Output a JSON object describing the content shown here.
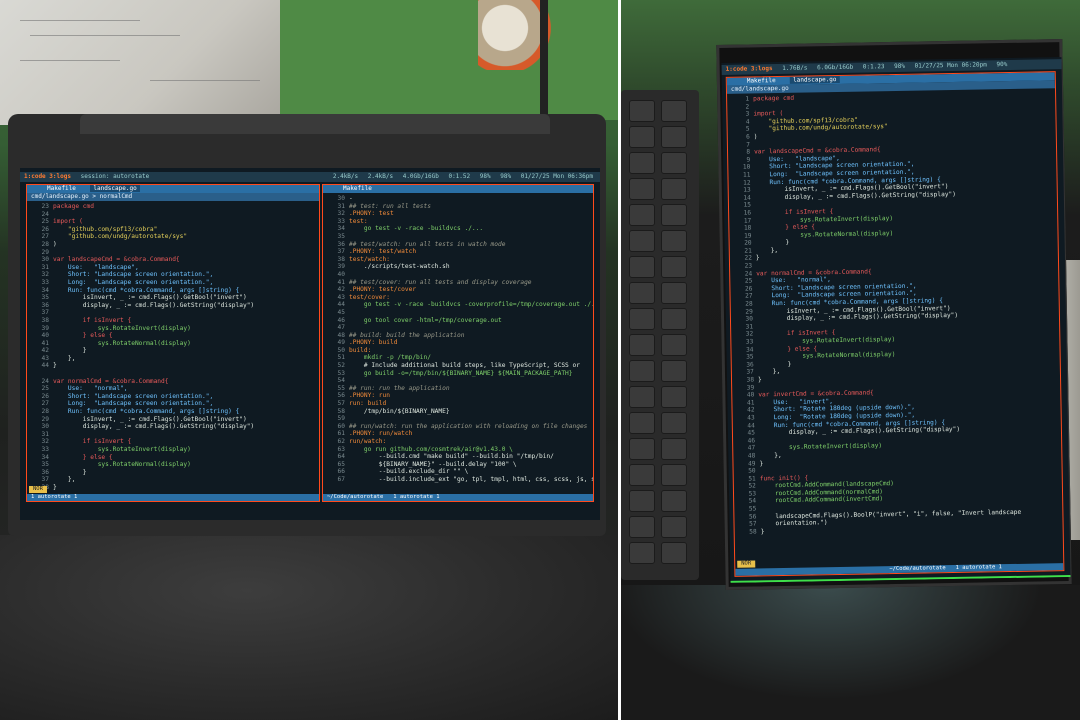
{
  "left": {
    "tmux": {
      "windows": "1:code  3:logs",
      "session": "session: autorotate",
      "net": "2.4kB/s",
      "net2": "2.4kB/s",
      "mem": "4.0Gb/16Gb",
      "load": "0:1.52",
      "batt": "98%",
      "batt2": "98%",
      "datetime": "01/27/25 Mon 06:36pm",
      "cpu": "4%"
    },
    "left_pane": {
      "tab1": "Makefile",
      "tab2": "landscape.go",
      "path": "cmd/landscape.go",
      "fn_hint": "normalCmd",
      "mode": "NOR",
      "bottom": "1 autorotate 1"
    },
    "right_pane": {
      "tab": "Makefile",
      "path": "~/Code/autorotate",
      "bottom": "1 autorotate 1"
    },
    "code_left": [
      {
        "n": "23",
        "t": "package cmd"
      },
      {
        "n": "24",
        "t": ""
      },
      {
        "n": "25",
        "t": "import ("
      },
      {
        "n": "26",
        "t": "    \"github.com/spf13/cobra\""
      },
      {
        "n": "27",
        "t": "    \"github.com/undg/autorotate/sys\""
      },
      {
        "n": "28",
        "t": ")"
      },
      {
        "n": "29",
        "t": ""
      },
      {
        "n": "30",
        "t": "var landscapeCmd = &cobra.Command{"
      },
      {
        "n": "31",
        "t": "    Use:   \"landscape\","
      },
      {
        "n": "32",
        "t": "    Short: \"Landscape screen orientation.\","
      },
      {
        "n": "33",
        "t": "    Long:  \"Landscape screen orientation.\","
      },
      {
        "n": "34",
        "t": "    Run: func(cmd *cobra.Command, args []string) {"
      },
      {
        "n": "35",
        "t": "        isInvert, _ := cmd.Flags().GetBool(\"invert\")"
      },
      {
        "n": "36",
        "t": "        display, _ := cmd.Flags().GetString(\"display\")"
      },
      {
        "n": "37",
        "t": ""
      },
      {
        "n": "38",
        "t": "        if isInvert {"
      },
      {
        "n": "39",
        "t": "            sys.RotateInvert(display)"
      },
      {
        "n": "40",
        "t": "        } else {"
      },
      {
        "n": "41",
        "t": "            sys.RotateNormal(display)"
      },
      {
        "n": "42",
        "t": "        }"
      },
      {
        "n": "43",
        "t": "    },"
      },
      {
        "n": "44",
        "t": "}"
      },
      {
        "n": "",
        "t": ""
      },
      {
        "n": "24",
        "t": "var normalCmd = &cobra.Command{"
      },
      {
        "n": "25",
        "t": "    Use:   \"normal\","
      },
      {
        "n": "26",
        "t": "    Short: \"Landscape screen orientation.\","
      },
      {
        "n": "27",
        "t": "    Long:  \"Landscape screen orientation.\","
      },
      {
        "n": "28",
        "t": "    Run: func(cmd *cobra.Command, args []string) {"
      },
      {
        "n": "29",
        "t": "        isInvert, _ := cmd.Flags().GetBool(\"invert\")"
      },
      {
        "n": "30",
        "t": "        display, _ := cmd.Flags().GetString(\"display\")"
      },
      {
        "n": "31",
        "t": ""
      },
      {
        "n": "32",
        "t": "        if isInvert {"
      },
      {
        "n": "33",
        "t": "            sys.RotateInvert(display)"
      },
      {
        "n": "34",
        "t": "        } else {"
      },
      {
        "n": "35",
        "t": "            sys.RotateNormal(display)"
      },
      {
        "n": "36",
        "t": "        }"
      },
      {
        "n": "37",
        "t": "    },"
      },
      {
        "n": "38",
        "t": "}"
      }
    ],
    "code_right": [
      {
        "n": "30",
        "t": "-"
      },
      {
        "n": "31",
        "t": "## test: run all tests"
      },
      {
        "n": "32",
        "t": ".PHONY: test"
      },
      {
        "n": "33",
        "t": "test:"
      },
      {
        "n": "34",
        "t": "    go test -v -race -buildvcs ./..."
      },
      {
        "n": "35",
        "t": ""
      },
      {
        "n": "36",
        "t": "## test/watch: run all tests in watch mode"
      },
      {
        "n": "37",
        "t": ".PHONY: test/watch"
      },
      {
        "n": "38",
        "t": "test/watch:"
      },
      {
        "n": "39",
        "t": "    ./scripts/test-watch.sh"
      },
      {
        "n": "40",
        "t": ""
      },
      {
        "n": "41",
        "t": "## test/cover: run all tests and display coverage"
      },
      {
        "n": "42",
        "t": ".PHONY: test/cover"
      },
      {
        "n": "43",
        "t": "test/cover:"
      },
      {
        "n": "44",
        "t": "    go test -v -race -buildvcs -coverprofile=/tmp/coverage.out ./..."
      },
      {
        "n": "45",
        "t": ""
      },
      {
        "n": "46",
        "t": "    go tool cover -html=/tmp/coverage.out"
      },
      {
        "n": "47",
        "t": ""
      },
      {
        "n": "48",
        "t": "## build: build the application"
      },
      {
        "n": "49",
        "t": ".PHONY: build"
      },
      {
        "n": "50",
        "t": "build:"
      },
      {
        "n": "51",
        "t": "    mkdir -p /tmp/bin/"
      },
      {
        "n": "52",
        "t": "    # Include additional build steps, like TypeScript, SCSS or"
      },
      {
        "n": "53",
        "t": "    go build -o=/tmp/bin/${BINARY_NAME} ${MAIN_PACKAGE_PATH}"
      },
      {
        "n": "54",
        "t": ""
      },
      {
        "n": "55",
        "t": "## run: run the application"
      },
      {
        "n": "56",
        "t": ".PHONY: run"
      },
      {
        "n": "57",
        "t": "run: build"
      },
      {
        "n": "58",
        "t": "    /tmp/bin/${BINARY_NAME}"
      },
      {
        "n": "59",
        "t": ""
      },
      {
        "n": "60",
        "t": "## run/watch: run the application with reloading on file changes"
      },
      {
        "n": "61",
        "t": ".PHONY: run/watch"
      },
      {
        "n": "62",
        "t": "run/watch:"
      },
      {
        "n": "63",
        "t": "    go run github.com/cosmtrek/air@v1.43.0 \\"
      },
      {
        "n": "64",
        "t": "        --build.cmd \"make build\" --build.bin \"/tmp/bin/"
      },
      {
        "n": "65",
        "t": "        ${BINARY_NAME}\" --build.delay \"100\" \\"
      },
      {
        "n": "66",
        "t": "        --build.exclude_dir \"\" \\"
      },
      {
        "n": "67",
        "t": "        --build.include_ext \"go, tpl, tmpl, html, css, scss, js, sql\""
      }
    ]
  },
  "right": {
    "tmux": {
      "windows": "1:code  3:logs",
      "net": "1.76B/s",
      "mem": "6.0Gb/16Gb",
      "load": "0:1.23",
      "batt": "98%",
      "datetime": "01/27/25 Mon 06:20pm",
      "cpu": "90%"
    },
    "pane": {
      "tab1": "Makefile",
      "tab2": "landscape.go",
      "path": "cmd/landscape.go",
      "mode": "NOR",
      "bottom_path": "~/Code/autorotate",
      "bottom": "1 autorotate 1"
    },
    "code": [
      {
        "n": "1",
        "t": "package cmd"
      },
      {
        "n": "2",
        "t": ""
      },
      {
        "n": "3",
        "t": "import ("
      },
      {
        "n": "4",
        "t": "    \"github.com/spf13/cobra\""
      },
      {
        "n": "5",
        "t": "    \"github.com/undg/autorotate/sys\""
      },
      {
        "n": "6",
        "t": ")"
      },
      {
        "n": "7",
        "t": ""
      },
      {
        "n": "8",
        "t": "var landscapeCmd = &cobra.Command{"
      },
      {
        "n": "9",
        "t": "    Use:   \"landscape\","
      },
      {
        "n": "10",
        "t": "    Short: \"Landscape screen orientation.\","
      },
      {
        "n": "11",
        "t": "    Long:  \"Landscape screen orientation.\","
      },
      {
        "n": "12",
        "t": "    Run: func(cmd *cobra.Command, args []string) {"
      },
      {
        "n": "13",
        "t": "        isInvert, _ := cmd.Flags().GetBool(\"invert\")"
      },
      {
        "n": "14",
        "t": "        display, _ := cmd.Flags().GetString(\"display\")"
      },
      {
        "n": "15",
        "t": ""
      },
      {
        "n": "16",
        "t": "        if isInvert {"
      },
      {
        "n": "17",
        "t": "            sys.RotateInvert(display)"
      },
      {
        "n": "18",
        "t": "        } else {"
      },
      {
        "n": "19",
        "t": "            sys.RotateNormal(display)"
      },
      {
        "n": "20",
        "t": "        }"
      },
      {
        "n": "21",
        "t": "    },"
      },
      {
        "n": "22",
        "t": "}"
      },
      {
        "n": "23",
        "t": ""
      },
      {
        "n": "24",
        "t": "var normalCmd = &cobra.Command{"
      },
      {
        "n": "25",
        "t": "    Use:   \"normal\","
      },
      {
        "n": "26",
        "t": "    Short: \"Landscape screen orientation.\","
      },
      {
        "n": "27",
        "t": "    Long:  \"Landscape screen orientation.\","
      },
      {
        "n": "28",
        "t": "    Run: func(cmd *cobra.Command, args []string) {"
      },
      {
        "n": "29",
        "t": "        isInvert, _ := cmd.Flags().GetBool(\"invert\")"
      },
      {
        "n": "30",
        "t": "        display, _ := cmd.Flags().GetString(\"display\")"
      },
      {
        "n": "31",
        "t": ""
      },
      {
        "n": "32",
        "t": "        if isInvert {"
      },
      {
        "n": "33",
        "t": "            sys.RotateInvert(display)"
      },
      {
        "n": "34",
        "t": "        } else {"
      },
      {
        "n": "35",
        "t": "            sys.RotateNormal(display)"
      },
      {
        "n": "36",
        "t": "        }"
      },
      {
        "n": "37",
        "t": "    },"
      },
      {
        "n": "38",
        "t": "}"
      },
      {
        "n": "39",
        "t": ""
      },
      {
        "n": "40",
        "t": "var invertCmd = &cobra.Command{"
      },
      {
        "n": "41",
        "t": "    Use:   \"invert\","
      },
      {
        "n": "42",
        "t": "    Short: \"Rotate 180deg (upside down).\","
      },
      {
        "n": "43",
        "t": "    Long:  \"Rotate 180deg (upside down).\","
      },
      {
        "n": "44",
        "t": "    Run: func(cmd *cobra.Command, args []string) {"
      },
      {
        "n": "45",
        "t": "        display, _ := cmd.Flags().GetString(\"display\")"
      },
      {
        "n": "46",
        "t": ""
      },
      {
        "n": "47",
        "t": "        sys.RotateInvert(display)"
      },
      {
        "n": "48",
        "t": "    },"
      },
      {
        "n": "49",
        "t": "}"
      },
      {
        "n": "50",
        "t": ""
      },
      {
        "n": "51",
        "t": "func init() {"
      },
      {
        "n": "52",
        "t": "    rootCmd.AddCommand(landscapeCmd)"
      },
      {
        "n": "53",
        "t": "    rootCmd.AddCommand(normalCmd)"
      },
      {
        "n": "54",
        "t": "    rootCmd.AddCommand(invertCmd)"
      },
      {
        "n": "55",
        "t": ""
      },
      {
        "n": "56",
        "t": "    landscapeCmd.Flags().BoolP(\"invert\", \"i\", false, \"Invert landscape"
      },
      {
        "n": "57",
        "t": "    orientation.\")"
      },
      {
        "n": "58",
        "t": "}"
      }
    ]
  }
}
